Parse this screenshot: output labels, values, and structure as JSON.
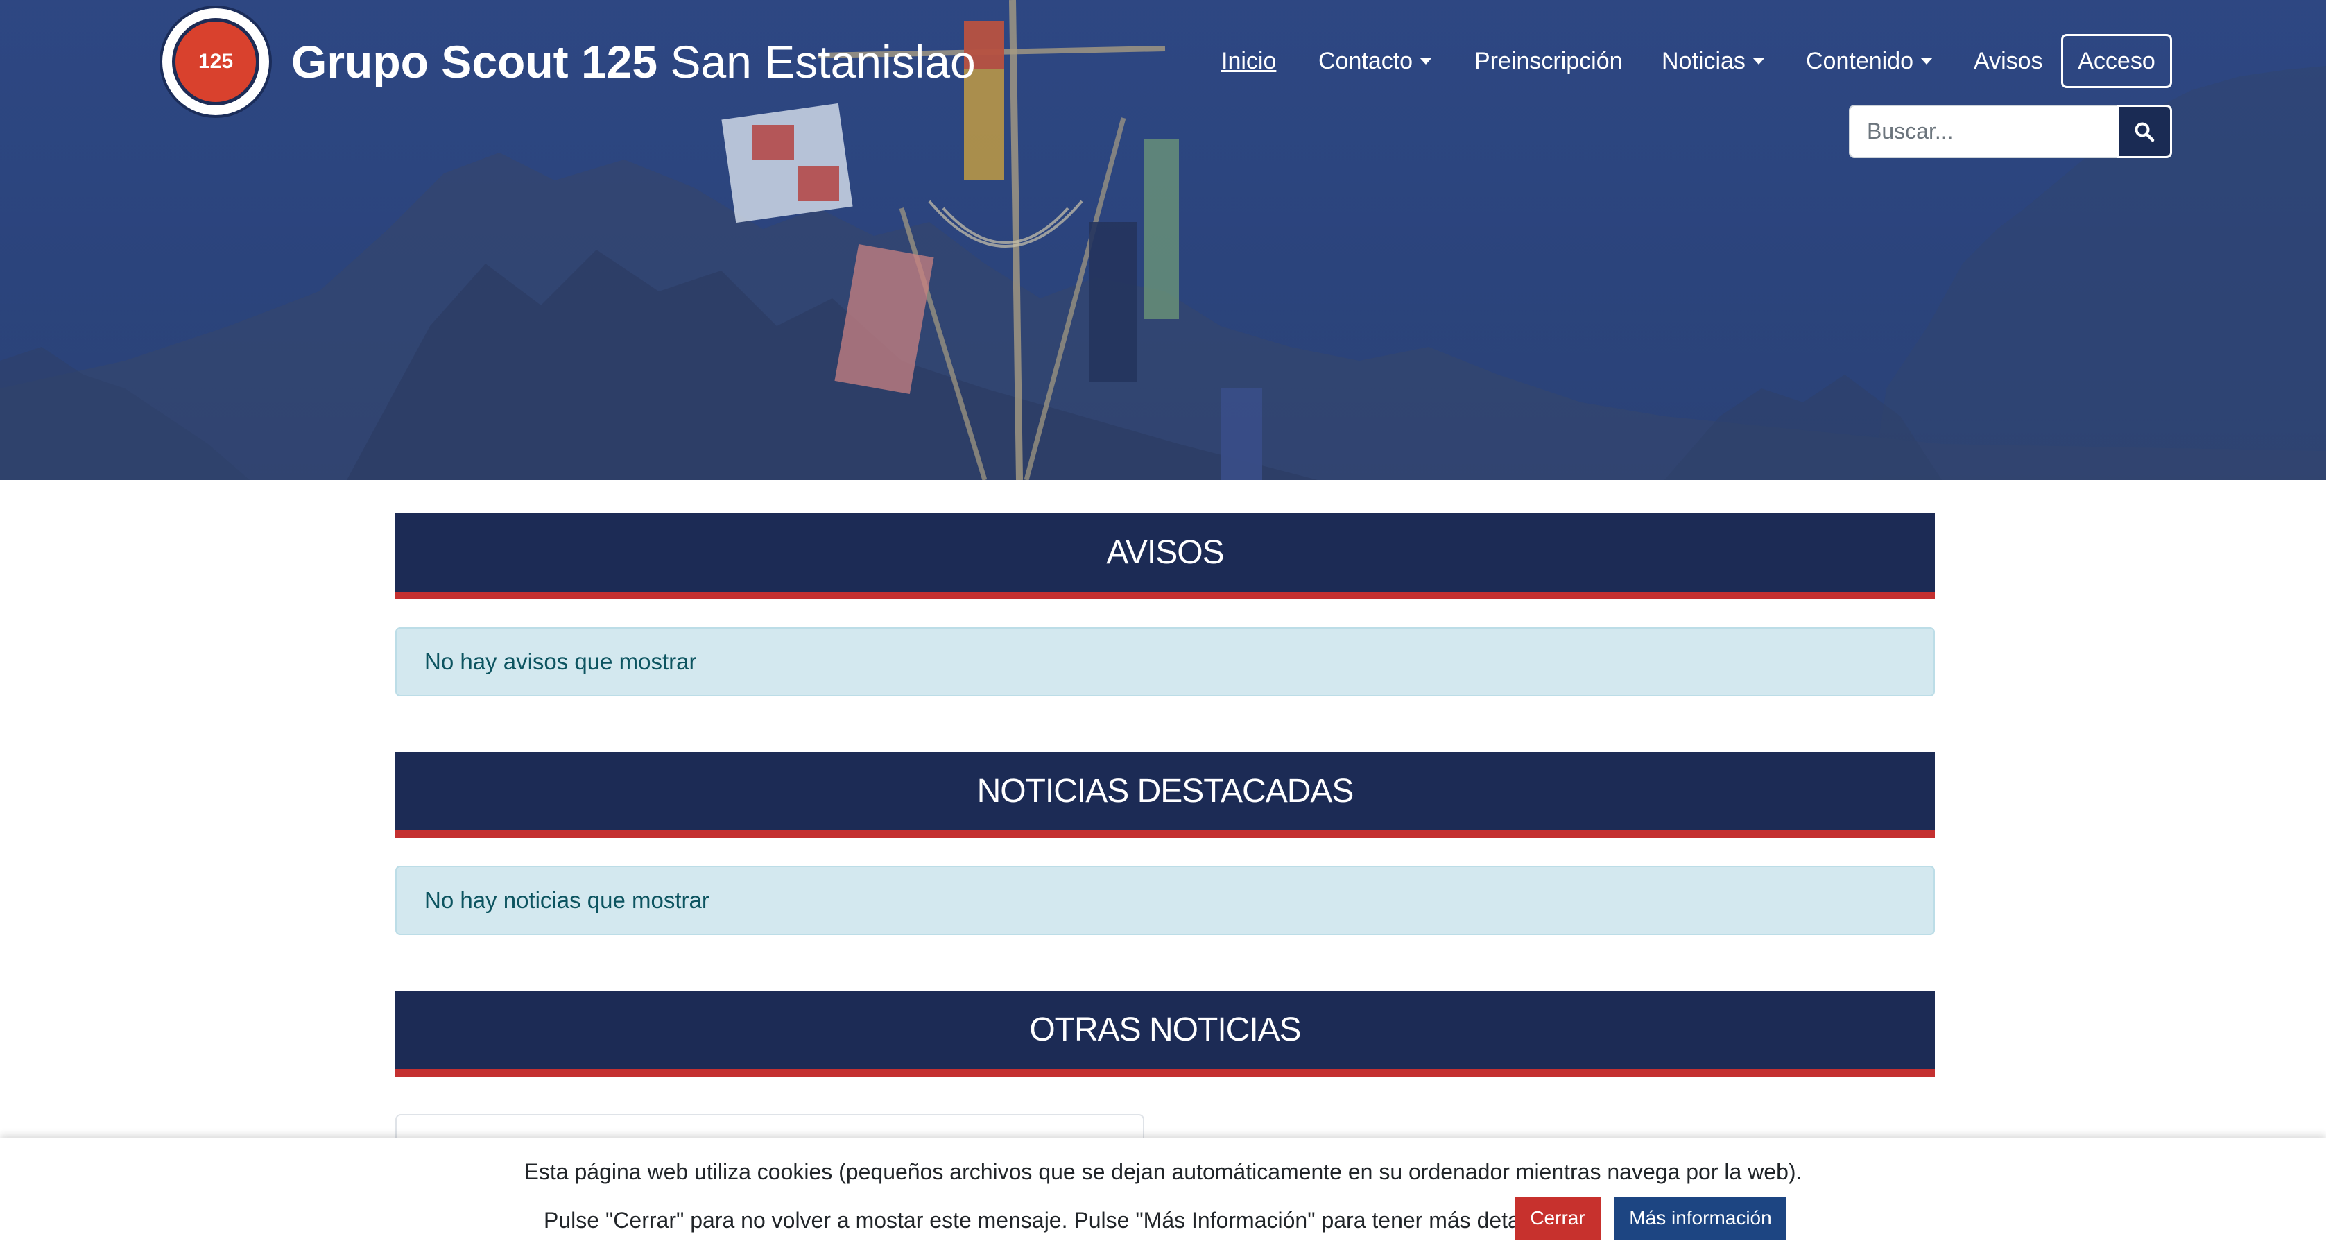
{
  "header": {
    "brand_bold": "Grupo Scout 125",
    "brand_light": "San Estanislao",
    "logo_text": "125"
  },
  "nav": {
    "items": [
      {
        "label": "Inicio",
        "active": true,
        "dropdown": false
      },
      {
        "label": "Contacto",
        "active": false,
        "dropdown": true
      },
      {
        "label": "Preinscripción",
        "active": false,
        "dropdown": false
      },
      {
        "label": "Noticias",
        "active": false,
        "dropdown": true
      },
      {
        "label": "Contenido",
        "active": false,
        "dropdown": true
      },
      {
        "label": "Avisos",
        "active": false,
        "dropdown": false
      }
    ],
    "login_label": "Acceso"
  },
  "search": {
    "placeholder": "Buscar...",
    "icon": "search-icon"
  },
  "sections": {
    "avisos": {
      "title": "AVISOS",
      "empty_message": "No hay avisos que mostrar"
    },
    "destacadas": {
      "title": "NOTICIAS DESTACADAS",
      "empty_message": "No hay noticias que mostrar"
    },
    "otras": {
      "title": "OTRAS NOTICIAS"
    }
  },
  "cookie": {
    "line1": "Esta página web utiliza cookies (pequeños archivos que se dejan automáticamente en su ordenador mientras navega por la web).",
    "line2": "Pulse \"Cerrar\" para no volver a mostar este mensaje. Pulse \"Más Información\" para tener más detalles.",
    "close_label": "Cerrar",
    "more_label": "Más información"
  },
  "colors": {
    "navy": "#1c2b55",
    "accent_red": "#c43030",
    "alert_bg": "#d3e8ef",
    "more_button": "#1d4582",
    "close_button": "#c7312d"
  }
}
